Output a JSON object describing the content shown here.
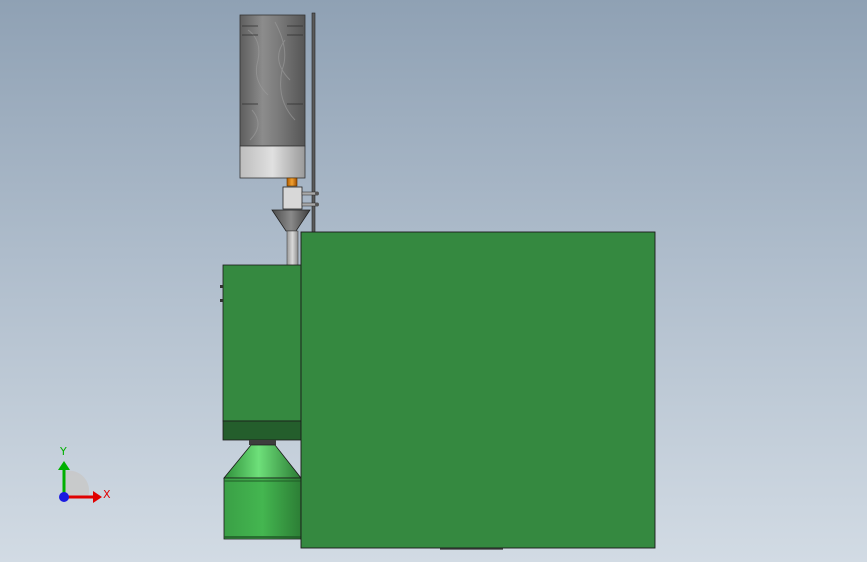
{
  "viewport": {
    "background_top": "#8fa1b4",
    "background_bottom": "#d2dbe4"
  },
  "model": {
    "main_color": "#358940",
    "cone_color": "#4ec45a",
    "metal_color": "#8a8a8a",
    "accent_color": "#e08a10"
  },
  "triad": {
    "x_label": "X",
    "y_label": "Y",
    "x_color": "#e00000",
    "y_color": "#00b000",
    "z_color": "#1a1ae0"
  }
}
